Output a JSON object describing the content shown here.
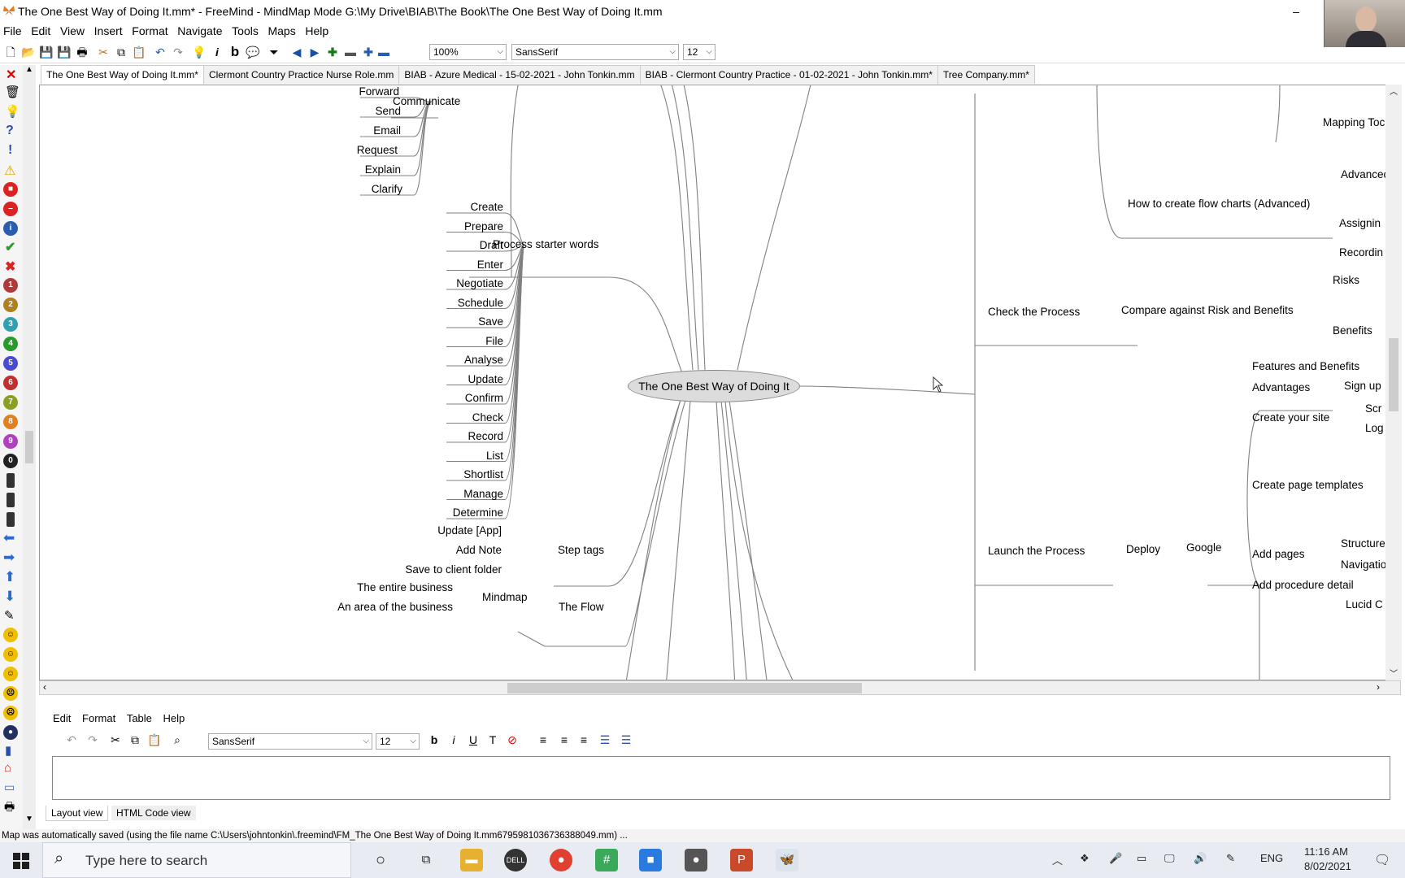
{
  "window": {
    "title": "The One Best Way of Doing It.mm* - FreeMind - MindMap Mode G:\\My Drive\\BIAB\\The Book\\The One Best Way of Doing It.mm",
    "minimize": "–",
    "maximize": "□",
    "close": "✕"
  },
  "menubar": [
    "File",
    "Edit",
    "View",
    "Insert",
    "Format",
    "Navigate",
    "Tools",
    "Maps",
    "Help"
  ],
  "toolbar": {
    "zoom": "100%",
    "font": "SansSerif",
    "size": "12"
  },
  "tabs": [
    "The One Best Way of Doing It.mm*",
    "Clermont Country Practice Nurse Role.mm",
    "BIAB - Azure Medical - 15-02-2021 - John Tonkin.mm",
    "BIAB - Clermont Country Practice - 01-02-2021 - John Tonkin.mm*",
    "Tree Company.mm*"
  ],
  "mindmap": {
    "root": "The One Best Way of Doing It",
    "communicate": {
      "label": "Communicate",
      "children": [
        "Forward",
        "Send",
        "Email",
        "Request",
        "Explain",
        "Clarify"
      ]
    },
    "process_starter": {
      "label": "Process starter words",
      "children": [
        "Create",
        "Prepare",
        "Draft",
        "Enter",
        "Negotiate",
        "Schedule",
        "Save",
        "File",
        "Analyse",
        "Update",
        "Confirm",
        "Check",
        "Record",
        "List",
        "Shortlist",
        "Manage",
        "Determine"
      ]
    },
    "step_tags": {
      "label": "Step tags",
      "children": [
        "Update [App]",
        "Add Note",
        "Save to client folder"
      ]
    },
    "the_flow": {
      "label": "The Flow",
      "mindmap": "Mindmap",
      "children": [
        "The entire business",
        "An area of the business"
      ]
    },
    "right": {
      "mapping_tools": "Mapping Toc",
      "flow_charts": "How to create flow charts (Advanced)",
      "flow_children": [
        "Advancec",
        "Assignin",
        "Recordin"
      ],
      "check_process": "Check the Process",
      "compare": "Compare against Risk and Benefits",
      "risks": "Risks",
      "benefits": "Benefits",
      "launch": "Launch the Process",
      "deploy": "Deploy",
      "google": "Google",
      "google_children": [
        "Features and Benefits",
        "Advantages",
        "Create your site",
        "Create page templates",
        "Add pages",
        "Add procedure detail"
      ],
      "signup": "Sign up",
      "scr": "Scr",
      "log": "Log",
      "structure": "Structure",
      "navigatio": "Navigatio",
      "lucid": "Lucid C"
    }
  },
  "notes": {
    "menu": [
      "Edit",
      "Format",
      "Table",
      "Help"
    ],
    "font": "SansSerif",
    "size": "12",
    "tabs": [
      "Layout view",
      "HTML Code view"
    ]
  },
  "status": "Map was automatically saved (using the file name C:\\Users\\johntonkin\\.freemind\\FM_The One Best Way of Doing It.mm6795981036736388049.mm) ...",
  "taskbar": {
    "search_placeholder": "Type here to search",
    "lang": "ENG",
    "time": "11:16 AM",
    "date": "8/02/2021"
  },
  "colors": {
    "root_fill": "#dcdcdc",
    "edge": "#808080",
    "taskbar": "#e8ecf2"
  }
}
